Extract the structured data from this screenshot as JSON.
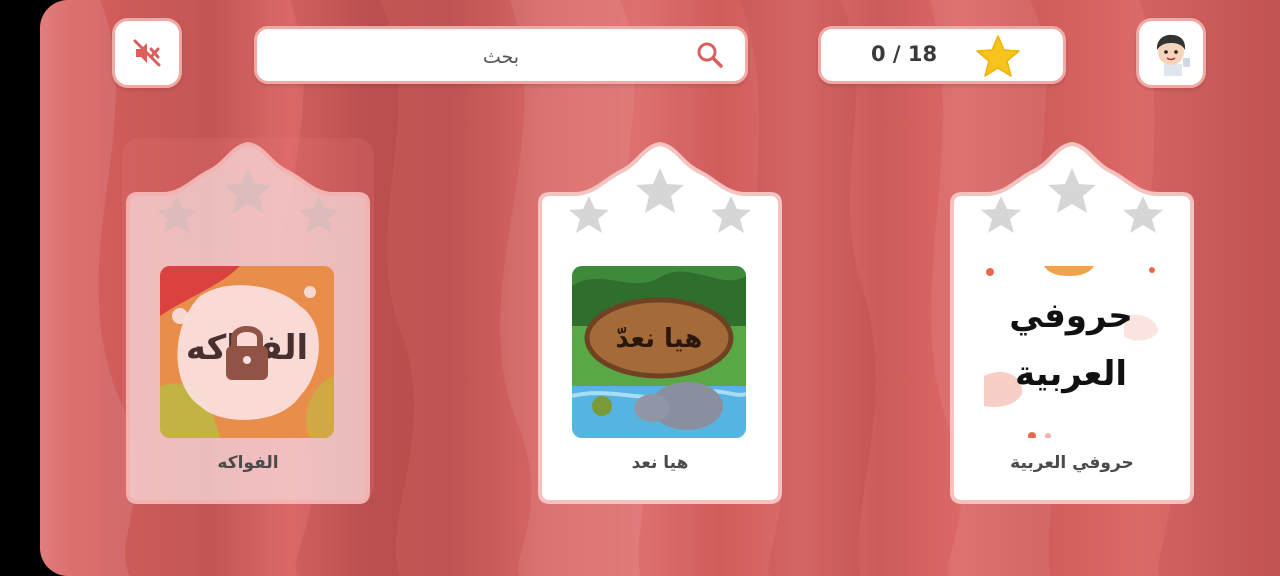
{
  "top_bar": {
    "mute_button": {
      "icon": "speaker-muted-icon"
    },
    "search": {
      "placeholder": "بحث",
      "icon": "search-icon"
    },
    "score": {
      "text": "0 / 18",
      "icon": "star-icon"
    },
    "profile": {
      "icon": "boy-avatar-icon"
    }
  },
  "lessons": [
    {
      "title": "حروفي العربية",
      "thumb_text_line1": "حروفي",
      "thumb_text_line2": "العربية",
      "locked": false,
      "stars_earned": 0,
      "stars_total": 3
    },
    {
      "title": "هيا نعد",
      "thumb_text": "هيا نعدّ",
      "locked": false,
      "stars_earned": 0,
      "stars_total": 3
    },
    {
      "title": "الفواكه",
      "thumb_text": "الفواكه",
      "locked": true,
      "stars_earned": 0,
      "stars_total": 3
    }
  ],
  "colors": {
    "background": "#d9605f",
    "card_border": "#f1a9a6",
    "star_gold": "#f7c31d",
    "star_empty": "#cfcfcf"
  }
}
